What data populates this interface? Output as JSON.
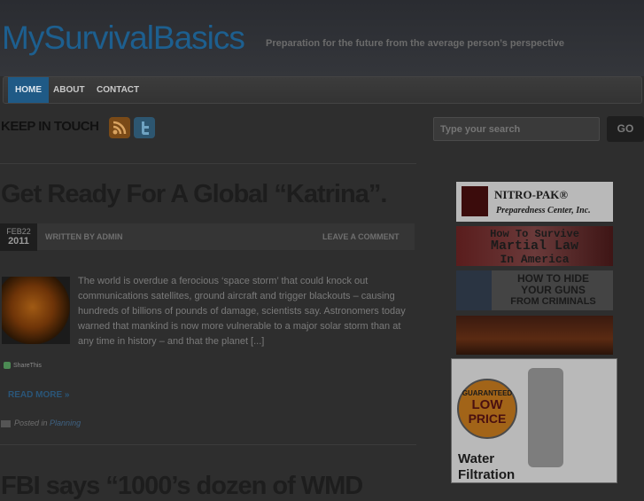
{
  "site": {
    "title": "MySurvivalBasics",
    "tagline": "Preparation for the future from the average person’s perspective"
  },
  "nav": {
    "items": [
      {
        "label": "HOME",
        "active": true
      },
      {
        "label": "ABOUT",
        "active": false
      },
      {
        "label": "CONTACT",
        "active": false
      }
    ]
  },
  "social": {
    "heading": "KEEP IN TOUCH",
    "icons": [
      "rss-icon",
      "twitter-icon"
    ]
  },
  "search": {
    "placeholder": "Type your search",
    "button": "GO"
  },
  "post": {
    "title": "Get Ready For A Global “Katrina”.",
    "date_month_day": "FEB22",
    "date_year": "2011",
    "author": "WRITTEN BY ADMIN",
    "comment": "LEAVE A COMMENT",
    "excerpt": "The world is overdue a ferocious ‘space storm’ that could knock out communications satellites, ground aircraft and trigger blackouts – causing hundreds of billions of pounds of damage, scientists say. Astronomers today warned that mankind is now more vulnerable to a major solar storm than at any time in history – and that the planet [...]",
    "share": "ShareThis",
    "read_more": "READ MORE »",
    "posted_in": "Posted in",
    "category": "Planning"
  },
  "next_post": {
    "title": "FBI says “1000’s dozen of WMD"
  },
  "ads": {
    "nitro_brand": "NITRO-PAK®",
    "nitro_sub": "Preparedness Center, Inc.",
    "martial_1": "How To Survive",
    "martial_2": "Martial Law",
    "martial_3": "In America",
    "guns_1": "HOW TO HIDE",
    "guns_2": "YOUR GUNS",
    "guns_3": "FROM CRIMINALS",
    "water_badge_1": "GUARANTEED",
    "water_badge_2": "LOW",
    "water_badge_3": "PRICE",
    "water_1": "Water",
    "water_2": "Filtration"
  }
}
